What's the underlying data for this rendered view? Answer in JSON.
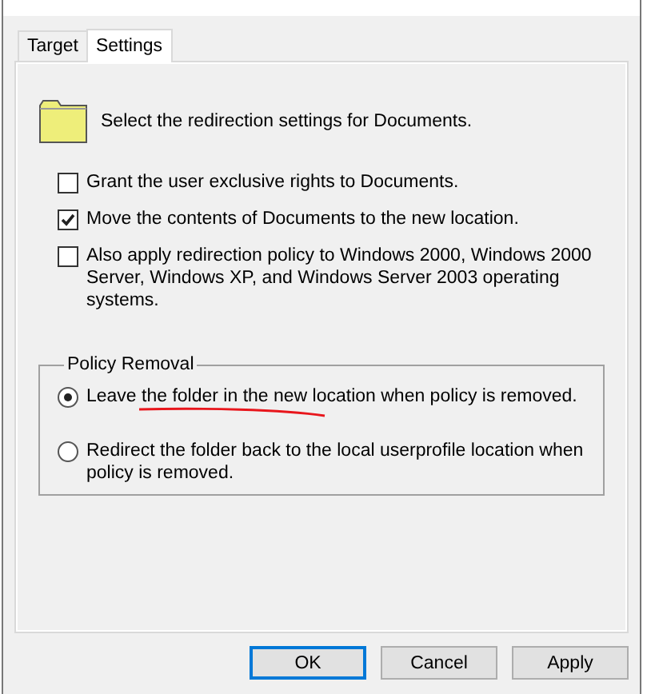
{
  "tabs": [
    {
      "label": "Target",
      "selected": false
    },
    {
      "label": "Settings",
      "selected": true
    }
  ],
  "header": {
    "text": "Select the redirection settings for Documents."
  },
  "options": [
    {
      "label": "Grant the user exclusive rights to Documents.",
      "checked": false
    },
    {
      "label": "Move the contents of Documents to the new location.",
      "checked": true
    },
    {
      "label": "Also apply redirection policy to Windows 2000, Windows 2000 Server, Windows XP, and Windows Server 2003 operating systems.",
      "checked": false
    }
  ],
  "policy_removal": {
    "title": "Policy Removal",
    "choices": [
      {
        "label": "Leave the folder in the new location when policy is removed.",
        "selected": true,
        "underlined": true
      },
      {
        "label": "Redirect the folder back to the local userprofile location when policy is removed.",
        "selected": false,
        "underlined": false
      }
    ]
  },
  "buttons": [
    {
      "label": "OK",
      "default": true
    },
    {
      "label": "Cancel",
      "default": false
    },
    {
      "label": "Apply",
      "default": false
    }
  ]
}
